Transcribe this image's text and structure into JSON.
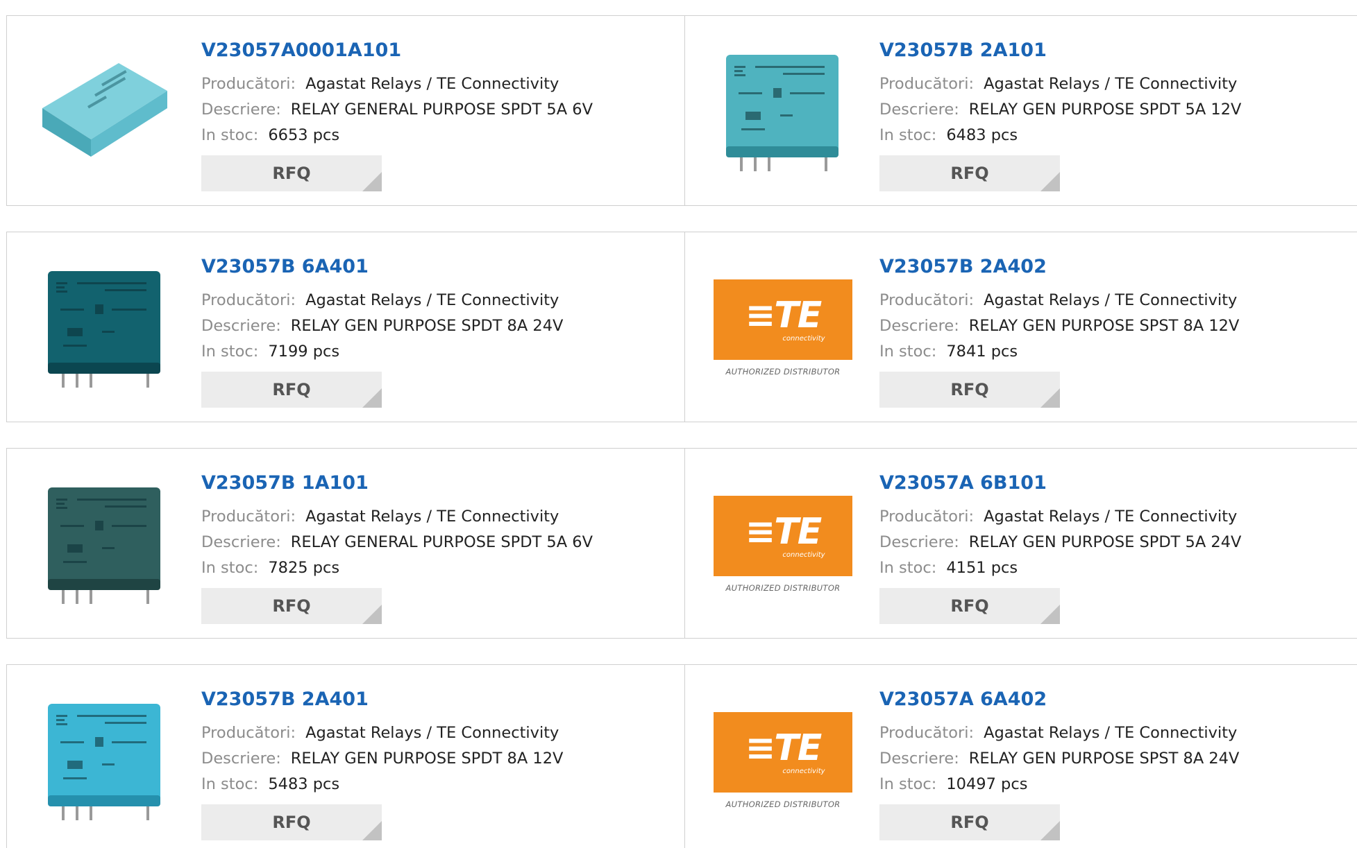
{
  "labels": {
    "manufacturer": "Producători:",
    "description": "Descriere:",
    "stock": "In stoc:",
    "rfq": "RFQ"
  },
  "brand": {
    "te_mark": "≡TE",
    "te_sub": "connectivity",
    "te_authorized": "AUTHORIZED DISTRIBUTOR",
    "te_orange": "#f28c1e",
    "link_color": "#1a64b4"
  },
  "products": [
    {
      "part": "V23057A0001A101",
      "manufacturer": "Agastat Relays / TE Connectivity",
      "description": "RELAY GENERAL PURPOSE SPDT 5A 6V",
      "stock": "6653 pcs",
      "image": "relay-flat-light"
    },
    {
      "part": "V23057B 2A101",
      "manufacturer": "Agastat Relays / TE Connectivity",
      "description": "RELAY GEN PURPOSE SPDT 5A 12V",
      "stock": "6483 pcs",
      "image": "relay-schrack-tyco"
    },
    {
      "part": "V23057B 6A401",
      "manufacturer": "Agastat Relays / TE Connectivity",
      "description": "RELAY GEN PURPOSE SPDT 8A 24V",
      "stock": "7199 pcs",
      "image": "relay-dark-teal"
    },
    {
      "part": "V23057B 2A402",
      "manufacturer": "Agastat Relays / TE Connectivity",
      "description": "RELAY GEN PURPOSE SPST 8A 12V",
      "stock": "7841 pcs",
      "image": "te-logo"
    },
    {
      "part": "V23057B 1A101",
      "manufacturer": "Agastat Relays / TE Connectivity",
      "description": "RELAY GENERAL PURPOSE SPDT 5A 6V",
      "stock": "7825 pcs",
      "image": "relay-dark-grey"
    },
    {
      "part": "V23057A 6B101",
      "manufacturer": "Agastat Relays / TE Connectivity",
      "description": "RELAY GEN PURPOSE SPDT 5A 24V",
      "stock": "4151 pcs",
      "image": "te-logo"
    },
    {
      "part": "V23057B 2A401",
      "manufacturer": "Agastat Relays / TE Connectivity",
      "description": "RELAY GEN PURPOSE SPDT 8A 12V",
      "stock": "5483 pcs",
      "image": "relay-bright-blue"
    },
    {
      "part": "V23057A 6A402",
      "manufacturer": "Agastat Relays / TE Connectivity",
      "description": "RELAY GEN PURPOSE SPST 8A 24V",
      "stock": "10497 pcs",
      "image": "te-logo"
    }
  ]
}
